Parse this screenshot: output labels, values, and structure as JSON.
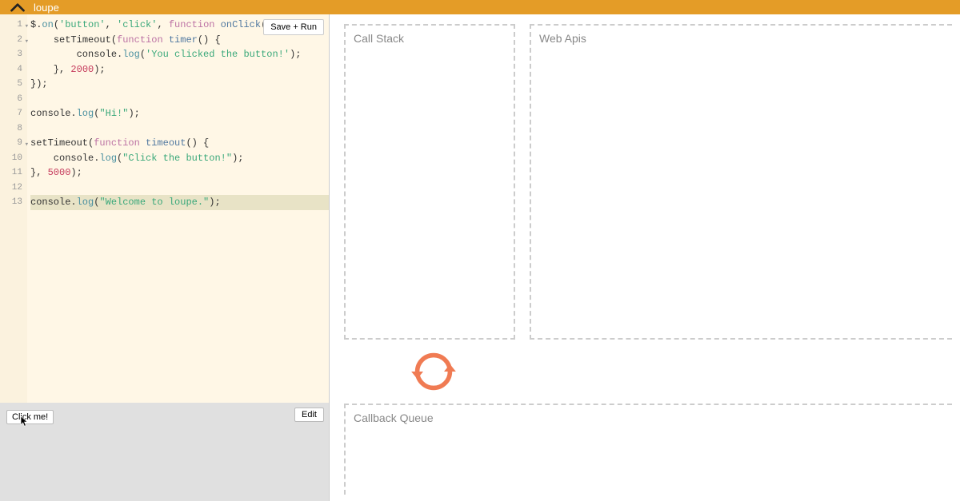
{
  "header": {
    "title": "loupe"
  },
  "editor": {
    "save_run_label": "Save + Run",
    "lines": [
      {
        "n": 1,
        "fold": true
      },
      {
        "n": 2,
        "fold": true
      },
      {
        "n": 3,
        "fold": false
      },
      {
        "n": 4,
        "fold": false
      },
      {
        "n": 5,
        "fold": false
      },
      {
        "n": 6,
        "fold": false
      },
      {
        "n": 7,
        "fold": false
      },
      {
        "n": 8,
        "fold": false
      },
      {
        "n": 9,
        "fold": true
      },
      {
        "n": 10,
        "fold": false
      },
      {
        "n": 11,
        "fold": false
      },
      {
        "n": 12,
        "fold": false
      },
      {
        "n": 13,
        "fold": false
      }
    ],
    "code_tokens": {
      "l1": {
        "a": "$.",
        "b": "on",
        "c": "(",
        "d": "'button'",
        "e": ", ",
        "f": "'click'",
        "g": ", ",
        "h": "function",
        "i": " ",
        "j": "onClick",
        "k": "() {"
      },
      "l2": {
        "a": "    ",
        "b": "setTimeout",
        "c": "(",
        "d": "function",
        "e": " ",
        "f": "timer",
        "g": "() {"
      },
      "l3": {
        "a": "        console.",
        "b": "log",
        "c": "(",
        "d": "'You clicked the button!'",
        "e": ");"
      },
      "l4": {
        "a": "    }, ",
        "b": "2000",
        "c": ");"
      },
      "l5": {
        "a": "});"
      },
      "l6": {
        "a": ""
      },
      "l7": {
        "a": "console.",
        "b": "log",
        "c": "(",
        "d": "\"Hi!\"",
        "e": ");"
      },
      "l8": {
        "a": ""
      },
      "l9": {
        "a": "setTimeout(",
        "b": "function",
        "c": " ",
        "d": "timeout",
        "e": "() {"
      },
      "l10": {
        "a": "    console.",
        "b": "log",
        "c": "(",
        "d": "\"Click the button!\"",
        "e": ");"
      },
      "l11": {
        "a": "}, ",
        "b": "5000",
        "c": ");"
      },
      "l12": {
        "a": ""
      },
      "l13": {
        "a": "console.",
        "b": "log",
        "c": "(",
        "d": "\"Welcome to loupe.\"",
        "e": ");"
      }
    },
    "highlighted_line": 13
  },
  "render": {
    "click_me_label": "Click me!",
    "edit_label": "Edit"
  },
  "panels": {
    "call_stack_label": "Call Stack",
    "web_apis_label": "Web Apis",
    "callback_queue_label": "Callback Queue"
  },
  "colors": {
    "accent": "#e49c27",
    "loop_icon": "#f07b53"
  }
}
